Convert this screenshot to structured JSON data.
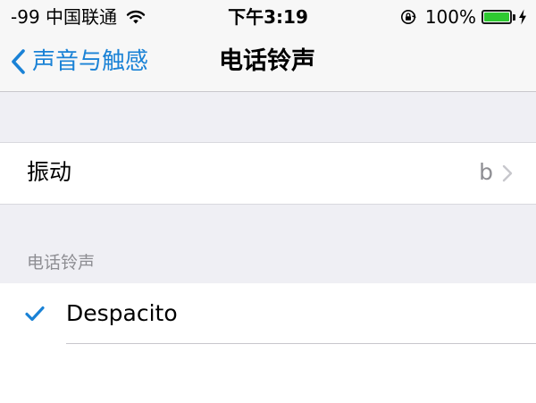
{
  "status_bar": {
    "carrier": "-99 中国联通",
    "time": "下午3:19",
    "battery_percent_text": "100%",
    "battery_level": 1.0,
    "battery_color": "#2ec931"
  },
  "nav": {
    "back_label": "声音与触感",
    "title": "电话铃声",
    "accent_color": "#1a82d6"
  },
  "vibration": {
    "label": "振动",
    "value": "b"
  },
  "ringtones": {
    "section_header": "电话铃声",
    "items": [
      {
        "label": "Despacito",
        "selected": true
      }
    ]
  },
  "icons": {
    "wifi": "wifi-icon",
    "rotation_lock": "rotation-lock-icon",
    "battery": "battery-icon",
    "charging": "charging-bolt-icon",
    "back": "chevron-left-icon",
    "disclosure": "chevron-right-icon",
    "selected": "checkmark-icon"
  }
}
